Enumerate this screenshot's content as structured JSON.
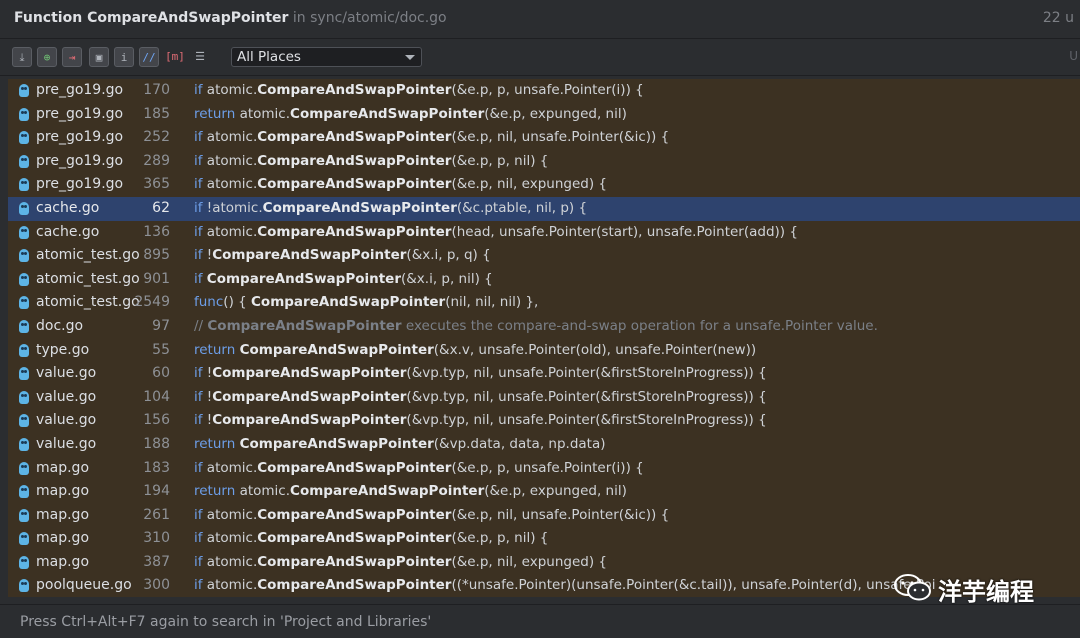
{
  "header": {
    "title_prefix": "Function ",
    "title_name": "CompareAndSwapPointer",
    "title_location": " in sync/atomic/doc.go",
    "count": "22 u"
  },
  "toolbar": {
    "buttons": [
      "pin-icon",
      "expand-icon",
      "collapse-icon",
      "group-by-directory-icon",
      "info-icon",
      "code-style-icon",
      "method-icon",
      "settings-icon"
    ],
    "scope": {
      "selected": "All Places"
    },
    "right_glyph": "U"
  },
  "results": [
    {
      "file": "pre_go19.go",
      "line": "170",
      "code": [
        [
          "kw",
          "if "
        ],
        [
          "t",
          "atomic."
        ],
        [
          "fn",
          "CompareAndSwapPointer"
        ],
        [
          "t",
          "(&e.p, p, unsafe.Pointer(i)) {"
        ]
      ]
    },
    {
      "file": "pre_go19.go",
      "line": "185",
      "code": [
        [
          "kw",
          "return "
        ],
        [
          "t",
          "atomic."
        ],
        [
          "fn",
          "CompareAndSwapPointer"
        ],
        [
          "t",
          "(&e.p, expunged, nil)"
        ]
      ]
    },
    {
      "file": "pre_go19.go",
      "line": "252",
      "code": [
        [
          "kw",
          "if "
        ],
        [
          "t",
          "atomic."
        ],
        [
          "fn",
          "CompareAndSwapPointer"
        ],
        [
          "t",
          "(&e.p, nil, unsafe.Pointer(&ic)) {"
        ]
      ]
    },
    {
      "file": "pre_go19.go",
      "line": "289",
      "code": [
        [
          "kw",
          "if "
        ],
        [
          "t",
          "atomic."
        ],
        [
          "fn",
          "CompareAndSwapPointer"
        ],
        [
          "t",
          "(&e.p, p, nil) {"
        ]
      ]
    },
    {
      "file": "pre_go19.go",
      "line": "365",
      "code": [
        [
          "kw",
          "if "
        ],
        [
          "t",
          "atomic."
        ],
        [
          "fn",
          "CompareAndSwapPointer"
        ],
        [
          "t",
          "(&e.p, nil, expunged) {"
        ]
      ]
    },
    {
      "file": "cache.go",
      "line": "62",
      "selected": true,
      "code": [
        [
          "kw",
          "if "
        ],
        [
          "t",
          "!atomic."
        ],
        [
          "fn",
          "CompareAndSwapPointer"
        ],
        [
          "t",
          "(&c.ptable, nil, p) {"
        ]
      ]
    },
    {
      "file": "cache.go",
      "line": "136",
      "code": [
        [
          "kw",
          "if "
        ],
        [
          "t",
          "atomic."
        ],
        [
          "fn",
          "CompareAndSwapPointer"
        ],
        [
          "t",
          "(head, unsafe.Pointer(start), unsafe.Pointer(add)) {"
        ]
      ]
    },
    {
      "file": "atomic_test.go",
      "line": "895",
      "code": [
        [
          "kw",
          "if "
        ],
        [
          "t",
          "!"
        ],
        [
          "fn",
          "CompareAndSwapPointer"
        ],
        [
          "t",
          "(&x.i, p, q) {"
        ]
      ]
    },
    {
      "file": "atomic_test.go",
      "line": "901",
      "code": [
        [
          "kw",
          "if "
        ],
        [
          "fn",
          "CompareAndSwapPointer"
        ],
        [
          "t",
          "(&x.i, p, nil) {"
        ]
      ]
    },
    {
      "file": "atomic_test.go",
      "line": "2549",
      "code": [
        [
          "kw",
          "func"
        ],
        [
          "t",
          "() { "
        ],
        [
          "fn",
          "CompareAndSwapPointer"
        ],
        [
          "t",
          "(nil, nil, nil) },"
        ]
      ]
    },
    {
      "file": "doc.go",
      "line": "97",
      "comment": true,
      "code": [
        [
          "cm",
          "// "
        ],
        [
          "cmfn",
          "CompareAndSwapPointer"
        ],
        [
          "cm",
          " executes the compare-and-swap operation for a unsafe.Pointer value."
        ]
      ]
    },
    {
      "file": "type.go",
      "line": "55",
      "code": [
        [
          "kw",
          "return "
        ],
        [
          "fn",
          "CompareAndSwapPointer"
        ],
        [
          "t",
          "(&x.v, unsafe.Pointer(old), unsafe.Pointer(new))"
        ]
      ]
    },
    {
      "file": "value.go",
      "line": "60",
      "code": [
        [
          "kw",
          "if "
        ],
        [
          "t",
          "!"
        ],
        [
          "fn",
          "CompareAndSwapPointer"
        ],
        [
          "t",
          "(&vp.typ, nil, unsafe.Pointer(&firstStoreInProgress)) {"
        ]
      ]
    },
    {
      "file": "value.go",
      "line": "104",
      "code": [
        [
          "kw",
          "if "
        ],
        [
          "t",
          "!"
        ],
        [
          "fn",
          "CompareAndSwapPointer"
        ],
        [
          "t",
          "(&vp.typ, nil, unsafe.Pointer(&firstStoreInProgress)) {"
        ]
      ]
    },
    {
      "file": "value.go",
      "line": "156",
      "code": [
        [
          "kw",
          "if "
        ],
        [
          "t",
          "!"
        ],
        [
          "fn",
          "CompareAndSwapPointer"
        ],
        [
          "t",
          "(&vp.typ, nil, unsafe.Pointer(&firstStoreInProgress)) {"
        ]
      ]
    },
    {
      "file": "value.go",
      "line": "188",
      "code": [
        [
          "kw",
          "return "
        ],
        [
          "fn",
          "CompareAndSwapPointer"
        ],
        [
          "t",
          "(&vp.data, data, np.data)"
        ]
      ]
    },
    {
      "file": "map.go",
      "line": "183",
      "code": [
        [
          "kw",
          "if "
        ],
        [
          "t",
          "atomic."
        ],
        [
          "fn",
          "CompareAndSwapPointer"
        ],
        [
          "t",
          "(&e.p, p, unsafe.Pointer(i)) {"
        ]
      ]
    },
    {
      "file": "map.go",
      "line": "194",
      "code": [
        [
          "kw",
          "return "
        ],
        [
          "t",
          "atomic."
        ],
        [
          "fn",
          "CompareAndSwapPointer"
        ],
        [
          "t",
          "(&e.p, expunged, nil)"
        ]
      ]
    },
    {
      "file": "map.go",
      "line": "261",
      "code": [
        [
          "kw",
          "if "
        ],
        [
          "t",
          "atomic."
        ],
        [
          "fn",
          "CompareAndSwapPointer"
        ],
        [
          "t",
          "(&e.p, nil, unsafe.Pointer(&ic)) {"
        ]
      ]
    },
    {
      "file": "map.go",
      "line": "310",
      "code": [
        [
          "kw",
          "if "
        ],
        [
          "t",
          "atomic."
        ],
        [
          "fn",
          "CompareAndSwapPointer"
        ],
        [
          "t",
          "(&e.p, p, nil) {"
        ]
      ]
    },
    {
      "file": "map.go",
      "line": "387",
      "code": [
        [
          "kw",
          "if "
        ],
        [
          "t",
          "atomic."
        ],
        [
          "fn",
          "CompareAndSwapPointer"
        ],
        [
          "t",
          "(&e.p, nil, expunged) {"
        ]
      ]
    },
    {
      "file": "poolqueue.go",
      "line": "300",
      "code": [
        [
          "kw",
          "if "
        ],
        [
          "t",
          "atomic."
        ],
        [
          "fn",
          "CompareAndSwapPointer"
        ],
        [
          "t",
          "((*unsafe.Pointer)(unsafe.Pointer(&c.tail)), unsafe.Pointer(d), unsafe.Poi"
        ]
      ]
    }
  ],
  "status": {
    "text": "Press Ctrl+Alt+F7 again to search in 'Project and Libraries'"
  },
  "watermark": {
    "text": "洋芋编程",
    "icon": "wechat-icon"
  },
  "colors": {
    "results_bg": "#3c3122",
    "selection_bg": "#2e436e",
    "keyword": "#6d9ee8"
  }
}
